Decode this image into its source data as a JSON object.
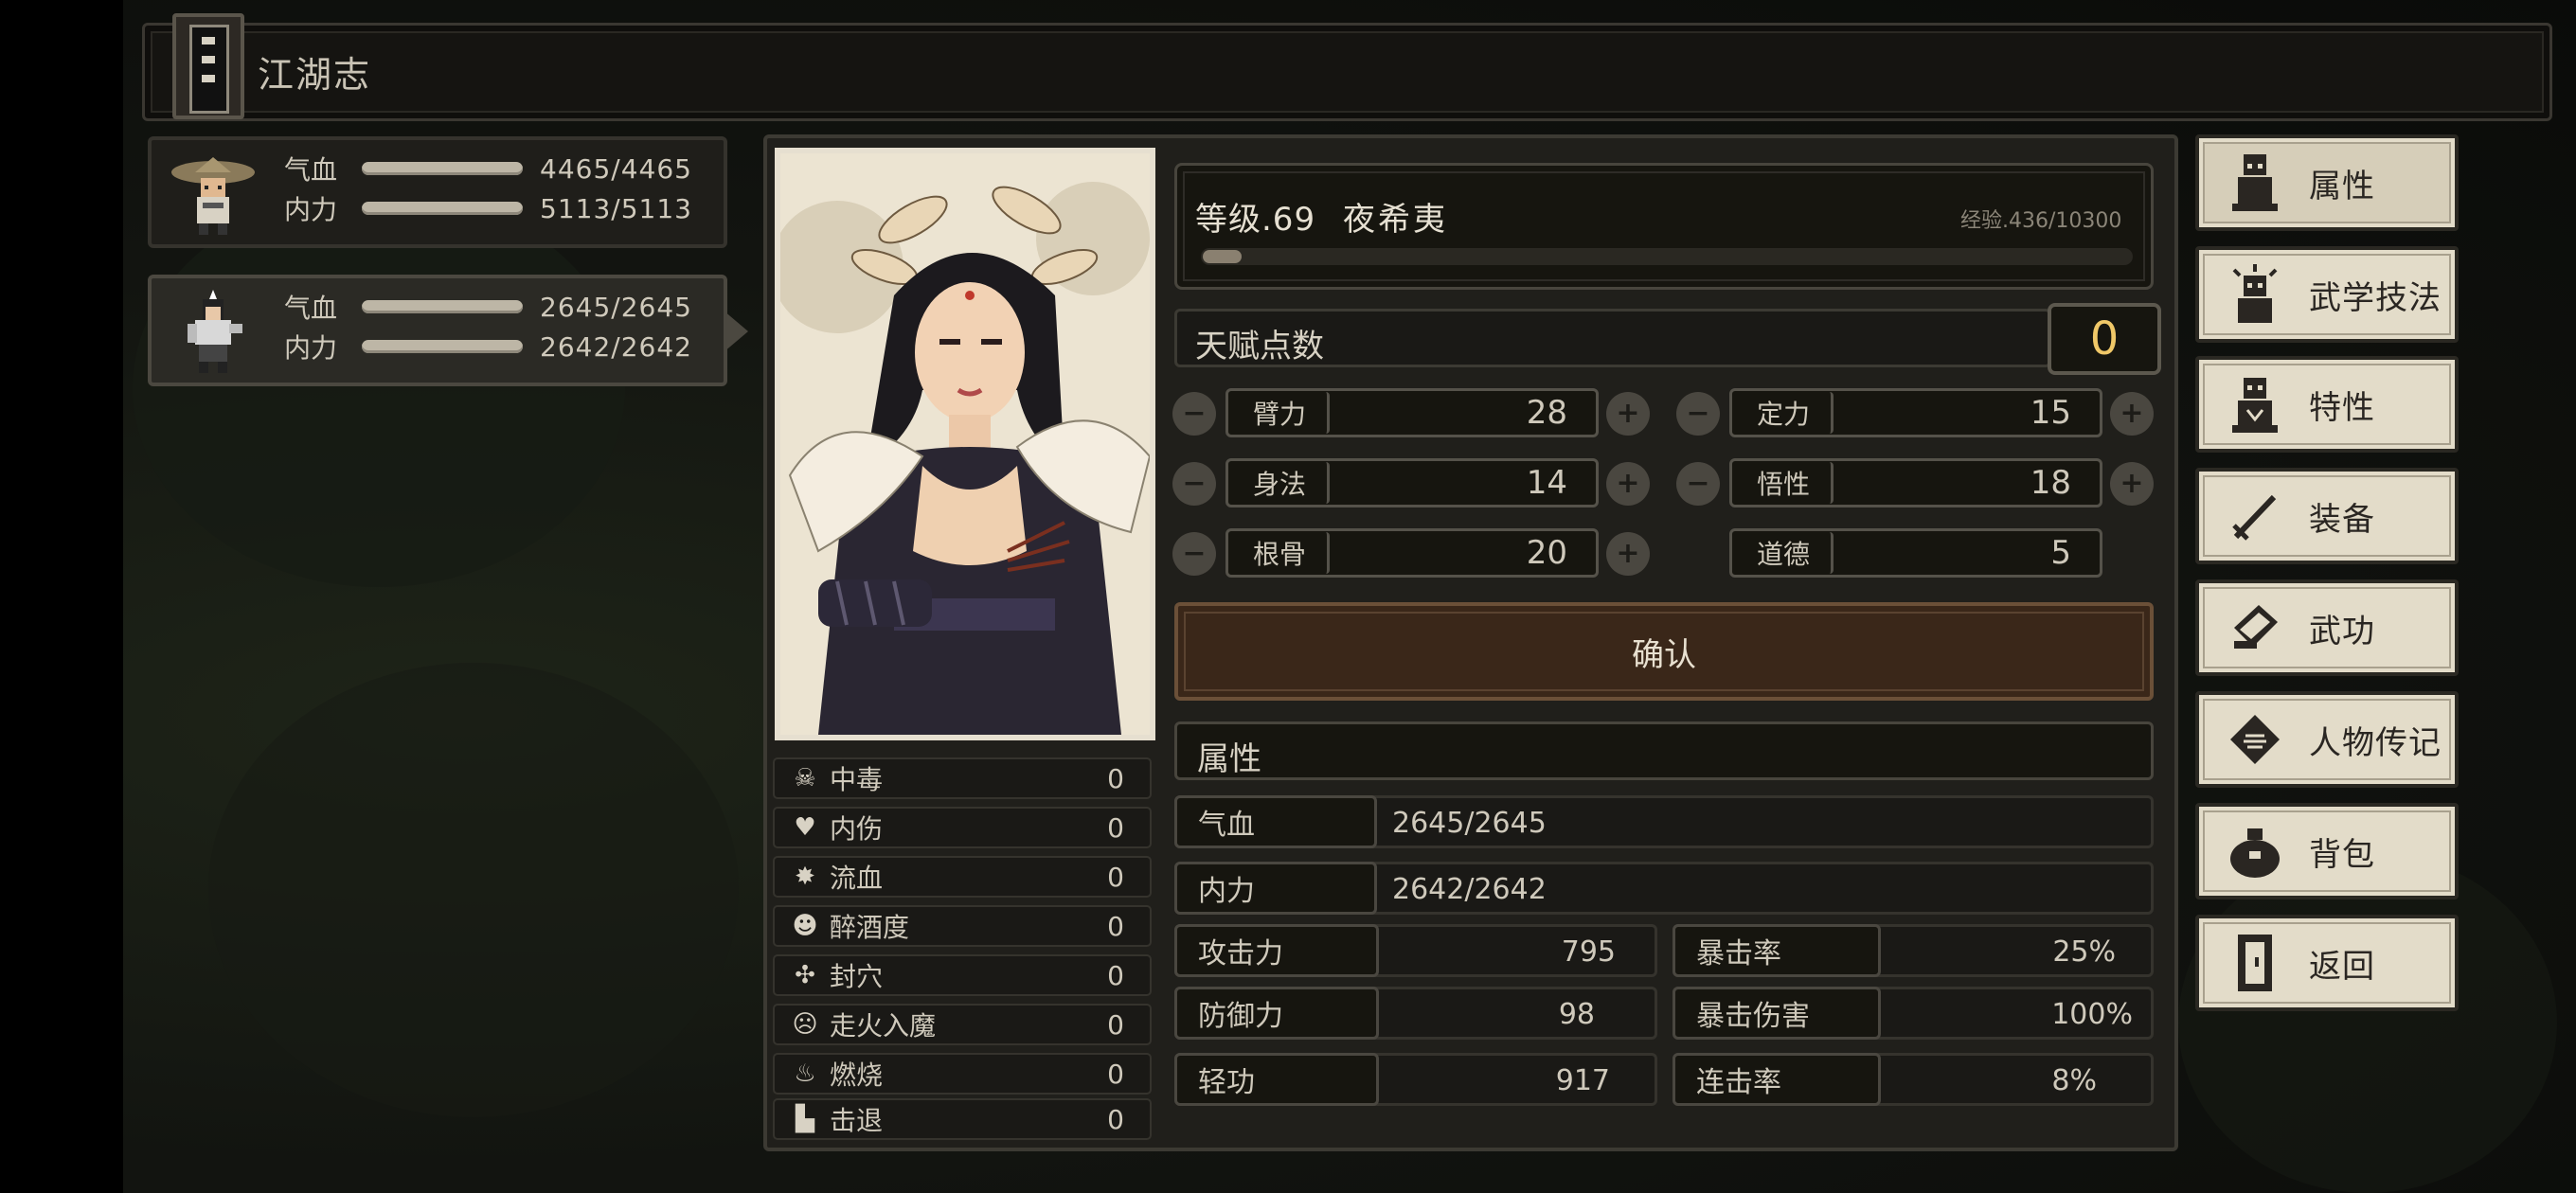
{
  "header": {
    "title": "江湖志"
  },
  "party": [
    {
      "hp_label": "气血",
      "hp": "4465/4465",
      "mp_label": "内力",
      "mp": "5113/5113",
      "selected": false
    },
    {
      "hp_label": "气血",
      "hp": "2645/2645",
      "mp_label": "内力",
      "mp": "2642/2642",
      "selected": true
    }
  ],
  "character": {
    "level": "等级.69",
    "name": "夜希夷",
    "exp": "经验.436/10300",
    "exp_fraction": 0.042
  },
  "talent": {
    "label": "天赋点数",
    "value": "0"
  },
  "allocators": [
    {
      "label": "臂力",
      "value": "28"
    },
    {
      "label": "定力",
      "value": "15"
    },
    {
      "label": "身法",
      "value": "14"
    },
    {
      "label": "悟性",
      "value": "18"
    },
    {
      "label": "根骨",
      "value": "20"
    },
    {
      "label": "道德",
      "value": "5"
    }
  ],
  "confirm_label": "确认",
  "attributes": {
    "title": "属性",
    "hp_label": "气血",
    "hp": "2645/2645",
    "mp_label": "内力",
    "mp": "2642/2642",
    "left": [
      {
        "label": "攻击力",
        "value": "795"
      },
      {
        "label": "防御力",
        "value": "98"
      },
      {
        "label": "轻功",
        "value": "917"
      }
    ],
    "right": [
      {
        "label": "暴击率",
        "value": "25%"
      },
      {
        "label": "暴击伤害",
        "value": "100%"
      },
      {
        "label": "连击率",
        "value": "8%"
      }
    ]
  },
  "ailments": [
    {
      "label": "中毒",
      "value": "0",
      "icon": "skull-icon"
    },
    {
      "label": "内伤",
      "value": "0",
      "icon": "broken-heart-icon"
    },
    {
      "label": "流血",
      "value": "0",
      "icon": "blood-drop-icon"
    },
    {
      "label": "醉酒度",
      "value": "0",
      "icon": "drunk-face-icon"
    },
    {
      "label": "封穴",
      "value": "0",
      "icon": "sealed-point-icon"
    },
    {
      "label": "走火入魔",
      "value": "0",
      "icon": "demon-face-icon"
    },
    {
      "label": "燃烧",
      "value": "0",
      "icon": "flame-icon"
    },
    {
      "label": "击退",
      "value": "0",
      "icon": "boot-icon"
    }
  ],
  "menu": [
    {
      "label": "属性",
      "icon": "character-icon",
      "active": true
    },
    {
      "label": "武学技法",
      "icon": "skills-icon",
      "active": false
    },
    {
      "label": "特性",
      "icon": "traits-icon",
      "active": false
    },
    {
      "label": "装备",
      "icon": "sword-icon",
      "active": false
    },
    {
      "label": "武功",
      "icon": "scroll-book-icon",
      "active": false
    },
    {
      "label": "人物传记",
      "icon": "biography-icon",
      "active": false
    },
    {
      "label": "背包",
      "icon": "bag-icon",
      "active": false
    },
    {
      "label": "返回",
      "icon": "exit-door-icon",
      "active": false
    }
  ]
}
